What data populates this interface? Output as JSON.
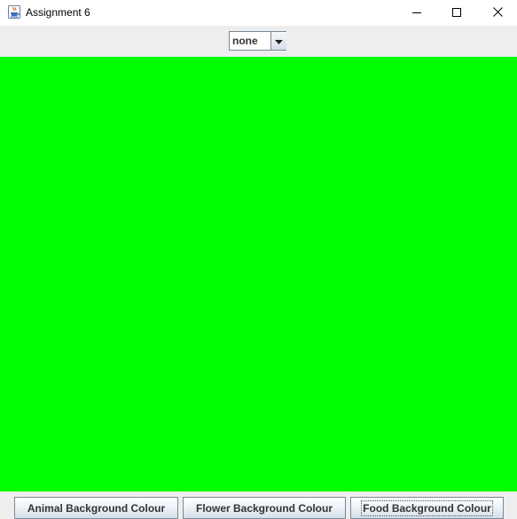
{
  "window": {
    "title": "Assignment 6",
    "icon": "java-cup-icon",
    "controls": {
      "minimize_icon": "minimize-icon",
      "maximize_icon": "maximize-icon",
      "close_icon": "close-icon"
    }
  },
  "toolbar": {
    "combo": {
      "selected": "none",
      "arrow_icon": "chevron-down-icon"
    }
  },
  "panel": {
    "background_color": "#00ff00"
  },
  "buttons": {
    "animal": "Animal Background Colour",
    "flower": "Flower Background Colour",
    "food": "Food Background Colour"
  },
  "colors": {
    "panel_green": "#00ff00",
    "button_border": "#7a8a99",
    "window_bg": "#eeeeee"
  }
}
